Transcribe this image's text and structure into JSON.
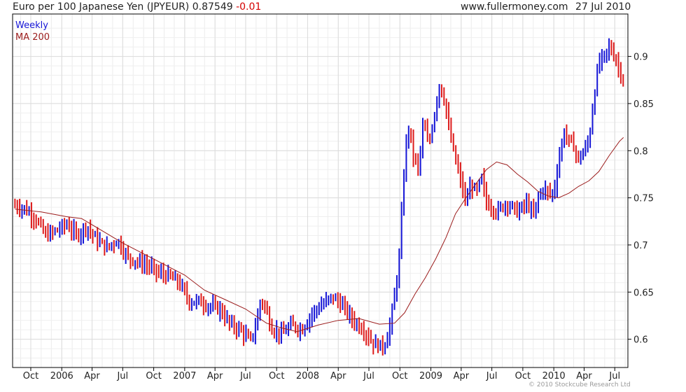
{
  "header": {
    "title": "Euro per 100 Japanese Yen (JPYEUR)",
    "last": "0.87549",
    "change": "-0.01",
    "source": "www.fullermoney.com",
    "date": "27 Jul 2010"
  },
  "credit": "© 2010 Stockcube Research Ltd",
  "colors": {
    "up": "#1515d6",
    "down": "#dd1b1b",
    "ma": "#9b1c1c",
    "grid": "#dcdcdc",
    "frame": "#000000"
  },
  "chart_data": {
    "type": "line",
    "subtype": "weekly-high-low-bars",
    "title": "Euro per 100 Japanese Yen (JPYEUR)",
    "grid": true,
    "legend_position": "top-left",
    "ylim": [
      0.57,
      0.945
    ],
    "y_ticks": [
      0.6,
      0.65,
      0.7,
      0.75,
      0.8,
      0.85,
      0.9
    ],
    "y_tick_labels": [
      "0.6",
      "0.65",
      "0.7",
      "0.75",
      "0.8",
      "0.85",
      "0.9"
    ],
    "xlim": [
      "2005-08-08",
      "2010-08-09"
    ],
    "x_ticks": [
      {
        "label": "Oct",
        "date": "2005-10-01"
      },
      {
        "label": "2006",
        "date": "2006-01-01"
      },
      {
        "label": "Apr",
        "date": "2006-04-01"
      },
      {
        "label": "Jul",
        "date": "2006-07-01"
      },
      {
        "label": "Oct",
        "date": "2006-10-01"
      },
      {
        "label": "2007",
        "date": "2007-01-01"
      },
      {
        "label": "Apr",
        "date": "2007-04-01"
      },
      {
        "label": "Jul",
        "date": "2007-07-01"
      },
      {
        "label": "Oct",
        "date": "2007-10-01"
      },
      {
        "label": "2008",
        "date": "2008-01-01"
      },
      {
        "label": "Apr",
        "date": "2008-04-01"
      },
      {
        "label": "Jul",
        "date": "2008-07-01"
      },
      {
        "label": "Oct",
        "date": "2008-10-01"
      },
      {
        "label": "2009",
        "date": "2009-01-01"
      },
      {
        "label": "Apr",
        "date": "2009-04-01"
      },
      {
        "label": "Jul",
        "date": "2009-07-01"
      },
      {
        "label": "Oct",
        "date": "2009-10-01"
      },
      {
        "label": "2010",
        "date": "2010-01-01"
      },
      {
        "label": "Apr",
        "date": "2010-04-01"
      },
      {
        "label": "Jul",
        "date": "2010-07-01"
      }
    ],
    "series": [
      {
        "name": "Weekly",
        "kind": "price",
        "points": [
          [
            "2005-08-15",
            0.742
          ],
          [
            "2005-09-15",
            0.738
          ],
          [
            "2005-10-15",
            0.728
          ],
          [
            "2005-11-15",
            0.71
          ],
          [
            "2005-12-15",
            0.715
          ],
          [
            "2006-01-15",
            0.722
          ],
          [
            "2006-02-15",
            0.71
          ],
          [
            "2006-03-15",
            0.72
          ],
          [
            "2006-04-15",
            0.705
          ],
          [
            "2006-05-15",
            0.697
          ],
          [
            "2006-06-15",
            0.705
          ],
          [
            "2006-07-15",
            0.687
          ],
          [
            "2006-08-15",
            0.682
          ],
          [
            "2006-09-15",
            0.678
          ],
          [
            "2006-10-15",
            0.67
          ],
          [
            "2006-11-15",
            0.667
          ],
          [
            "2006-12-15",
            0.66
          ],
          [
            "2007-01-15",
            0.64
          ],
          [
            "2007-02-15",
            0.64
          ],
          [
            "2007-03-15",
            0.635
          ],
          [
            "2007-04-15",
            0.632
          ],
          [
            "2007-05-15",
            0.616
          ],
          [
            "2007-06-15",
            0.61
          ],
          [
            "2007-07-15",
            0.598
          ],
          [
            "2007-08-01",
            0.615
          ],
          [
            "2007-08-15",
            0.643
          ],
          [
            "2007-09-01",
            0.63
          ],
          [
            "2007-09-15",
            0.612
          ],
          [
            "2007-10-15",
            0.605
          ],
          [
            "2007-11-15",
            0.615
          ],
          [
            "2007-12-15",
            0.61
          ],
          [
            "2008-01-15",
            0.628
          ],
          [
            "2008-02-15",
            0.637
          ],
          [
            "2008-03-15",
            0.645
          ],
          [
            "2008-04-15",
            0.635
          ],
          [
            "2008-05-15",
            0.62
          ],
          [
            "2008-06-15",
            0.61
          ],
          [
            "2008-07-15",
            0.595
          ],
          [
            "2008-08-15",
            0.592
          ],
          [
            "2008-08-31",
            0.612
          ],
          [
            "2008-09-15",
            0.645
          ],
          [
            "2008-09-30",
            0.69
          ],
          [
            "2008-10-10",
            0.76
          ],
          [
            "2008-10-24",
            0.83
          ],
          [
            "2008-11-10",
            0.795
          ],
          [
            "2008-11-25",
            0.78
          ],
          [
            "2008-12-10",
            0.83
          ],
          [
            "2008-12-25",
            0.805
          ],
          [
            "2009-01-10",
            0.835
          ],
          [
            "2009-01-25",
            0.87
          ],
          [
            "2009-02-10",
            0.855
          ],
          [
            "2009-02-25",
            0.82
          ],
          [
            "2009-03-15",
            0.79
          ],
          [
            "2009-04-01",
            0.765
          ],
          [
            "2009-04-15",
            0.745
          ],
          [
            "2009-05-01",
            0.765
          ],
          [
            "2009-05-15",
            0.755
          ],
          [
            "2009-06-01",
            0.77
          ],
          [
            "2009-06-15",
            0.745
          ],
          [
            "2009-07-01",
            0.74
          ],
          [
            "2009-07-15",
            0.735
          ],
          [
            "2009-08-15",
            0.745
          ],
          [
            "2009-09-15",
            0.735
          ],
          [
            "2009-10-15",
            0.745
          ],
          [
            "2009-11-01",
            0.73
          ],
          [
            "2009-11-15",
            0.75
          ],
          [
            "2009-12-01",
            0.76
          ],
          [
            "2009-12-15",
            0.755
          ],
          [
            "2010-01-01",
            0.755
          ],
          [
            "2010-01-15",
            0.79
          ],
          [
            "2010-02-01",
            0.82
          ],
          [
            "2010-02-15",
            0.81
          ],
          [
            "2010-03-01",
            0.805
          ],
          [
            "2010-03-15",
            0.79
          ],
          [
            "2010-04-01",
            0.8
          ],
          [
            "2010-04-15",
            0.81
          ],
          [
            "2010-05-01",
            0.86
          ],
          [
            "2010-05-15",
            0.895
          ],
          [
            "2010-06-01",
            0.9
          ],
          [
            "2010-06-15",
            0.91
          ],
          [
            "2010-07-01",
            0.9
          ],
          [
            "2010-07-15",
            0.885
          ],
          [
            "2010-07-27",
            0.87549
          ]
        ]
      },
      {
        "name": "MA 200",
        "kind": "moving-average",
        "points": [
          [
            "2005-08-15",
            0.738
          ],
          [
            "2005-11-01",
            0.735
          ],
          [
            "2006-01-15",
            0.73
          ],
          [
            "2006-03-01",
            0.728
          ],
          [
            "2006-05-01",
            0.715
          ],
          [
            "2006-07-01",
            0.702
          ],
          [
            "2006-10-01",
            0.685
          ],
          [
            "2007-01-01",
            0.668
          ],
          [
            "2007-03-01",
            0.652
          ],
          [
            "2007-05-01",
            0.642
          ],
          [
            "2007-07-01",
            0.632
          ],
          [
            "2007-09-01",
            0.617
          ],
          [
            "2007-10-15",
            0.612
          ],
          [
            "2007-12-01",
            0.608
          ],
          [
            "2008-02-01",
            0.615
          ],
          [
            "2008-04-01",
            0.62
          ],
          [
            "2008-06-01",
            0.622
          ],
          [
            "2008-08-01",
            0.616
          ],
          [
            "2008-09-15",
            0.617
          ],
          [
            "2008-10-15",
            0.628
          ],
          [
            "2008-11-15",
            0.648
          ],
          [
            "2008-12-15",
            0.665
          ],
          [
            "2009-01-15",
            0.685
          ],
          [
            "2009-02-15",
            0.708
          ],
          [
            "2009-03-15",
            0.733
          ],
          [
            "2009-04-15",
            0.75
          ],
          [
            "2009-05-15",
            0.765
          ],
          [
            "2009-06-15",
            0.78
          ],
          [
            "2009-07-15",
            0.788
          ],
          [
            "2009-08-15",
            0.785
          ],
          [
            "2009-09-15",
            0.775
          ],
          [
            "2009-10-15",
            0.767
          ],
          [
            "2009-11-15",
            0.757
          ],
          [
            "2009-12-15",
            0.752
          ],
          [
            "2010-01-15",
            0.75
          ],
          [
            "2010-02-15",
            0.755
          ],
          [
            "2010-03-15",
            0.762
          ],
          [
            "2010-04-15",
            0.768
          ],
          [
            "2010-05-15",
            0.778
          ],
          [
            "2010-06-15",
            0.795
          ],
          [
            "2010-07-15",
            0.81
          ],
          [
            "2010-07-27",
            0.814
          ]
        ]
      }
    ]
  }
}
